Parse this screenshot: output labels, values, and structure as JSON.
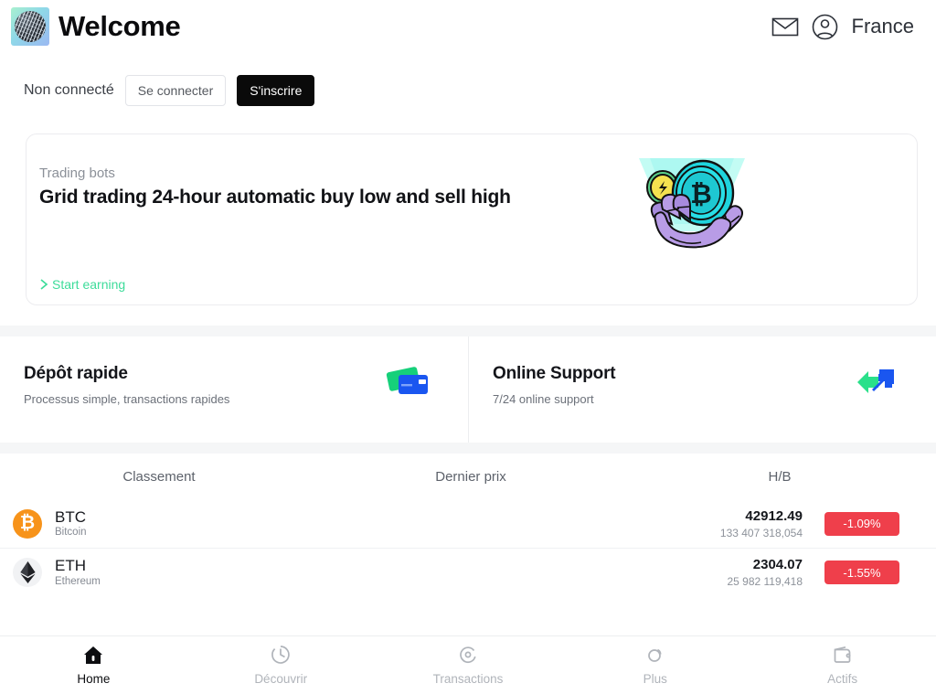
{
  "header": {
    "app_title": "Welcome",
    "logo_icon": "globe-sphere-logo",
    "mail_icon": "envelope-icon",
    "account_icon": "user-circle-icon",
    "region": "France"
  },
  "auth": {
    "status": "Non connecté",
    "login_label": "Se connecter",
    "signup_label": "S'inscrire"
  },
  "promo": {
    "kicker": "Trading bots",
    "title": "Grid trading 24-hour automatic buy low and sell high",
    "cta_chevron": "chevron-right-icon",
    "cta_label": "Start earning",
    "art_icon": "robot-hand-bitcoin-illustration",
    "accent_color": "#3ddc9a"
  },
  "features": [
    {
      "title": "Dépôt rapide",
      "subtitle": "Processus simple, transactions rapides",
      "icon": "credit-cards-icon"
    },
    {
      "title": "Online Support",
      "subtitle": "7/24 online support",
      "icon": "two-arrows-icon"
    }
  ],
  "market": {
    "columns": [
      "Classement",
      "Dernier prix",
      "H/B"
    ],
    "rows": [
      {
        "symbol": "BTC",
        "name": "Bitcoin",
        "icon": "bitcoin-coin-icon",
        "price": "42912.49",
        "volume": "133 407 318,054",
        "change": "-1.09%",
        "change_color": "#ef3f4b"
      },
      {
        "symbol": "ETH",
        "name": "Ethereum",
        "icon": "ethereum-coin-icon",
        "price": "2304.07",
        "volume": "25 982 119,418",
        "change": "-1.55%",
        "change_color": "#ef3f4b"
      }
    ]
  },
  "bottom_nav": [
    {
      "label": "Home",
      "icon": "home-icon",
      "active": true
    },
    {
      "label": "Découvrir",
      "icon": "compass-icon",
      "active": false
    },
    {
      "label": "Transactions",
      "icon": "refresh-dot-icon",
      "active": false
    },
    {
      "label": "Plus",
      "icon": "circles-more-icon",
      "active": false
    },
    {
      "label": "Actifs",
      "icon": "wallet-icon",
      "active": false
    }
  ]
}
